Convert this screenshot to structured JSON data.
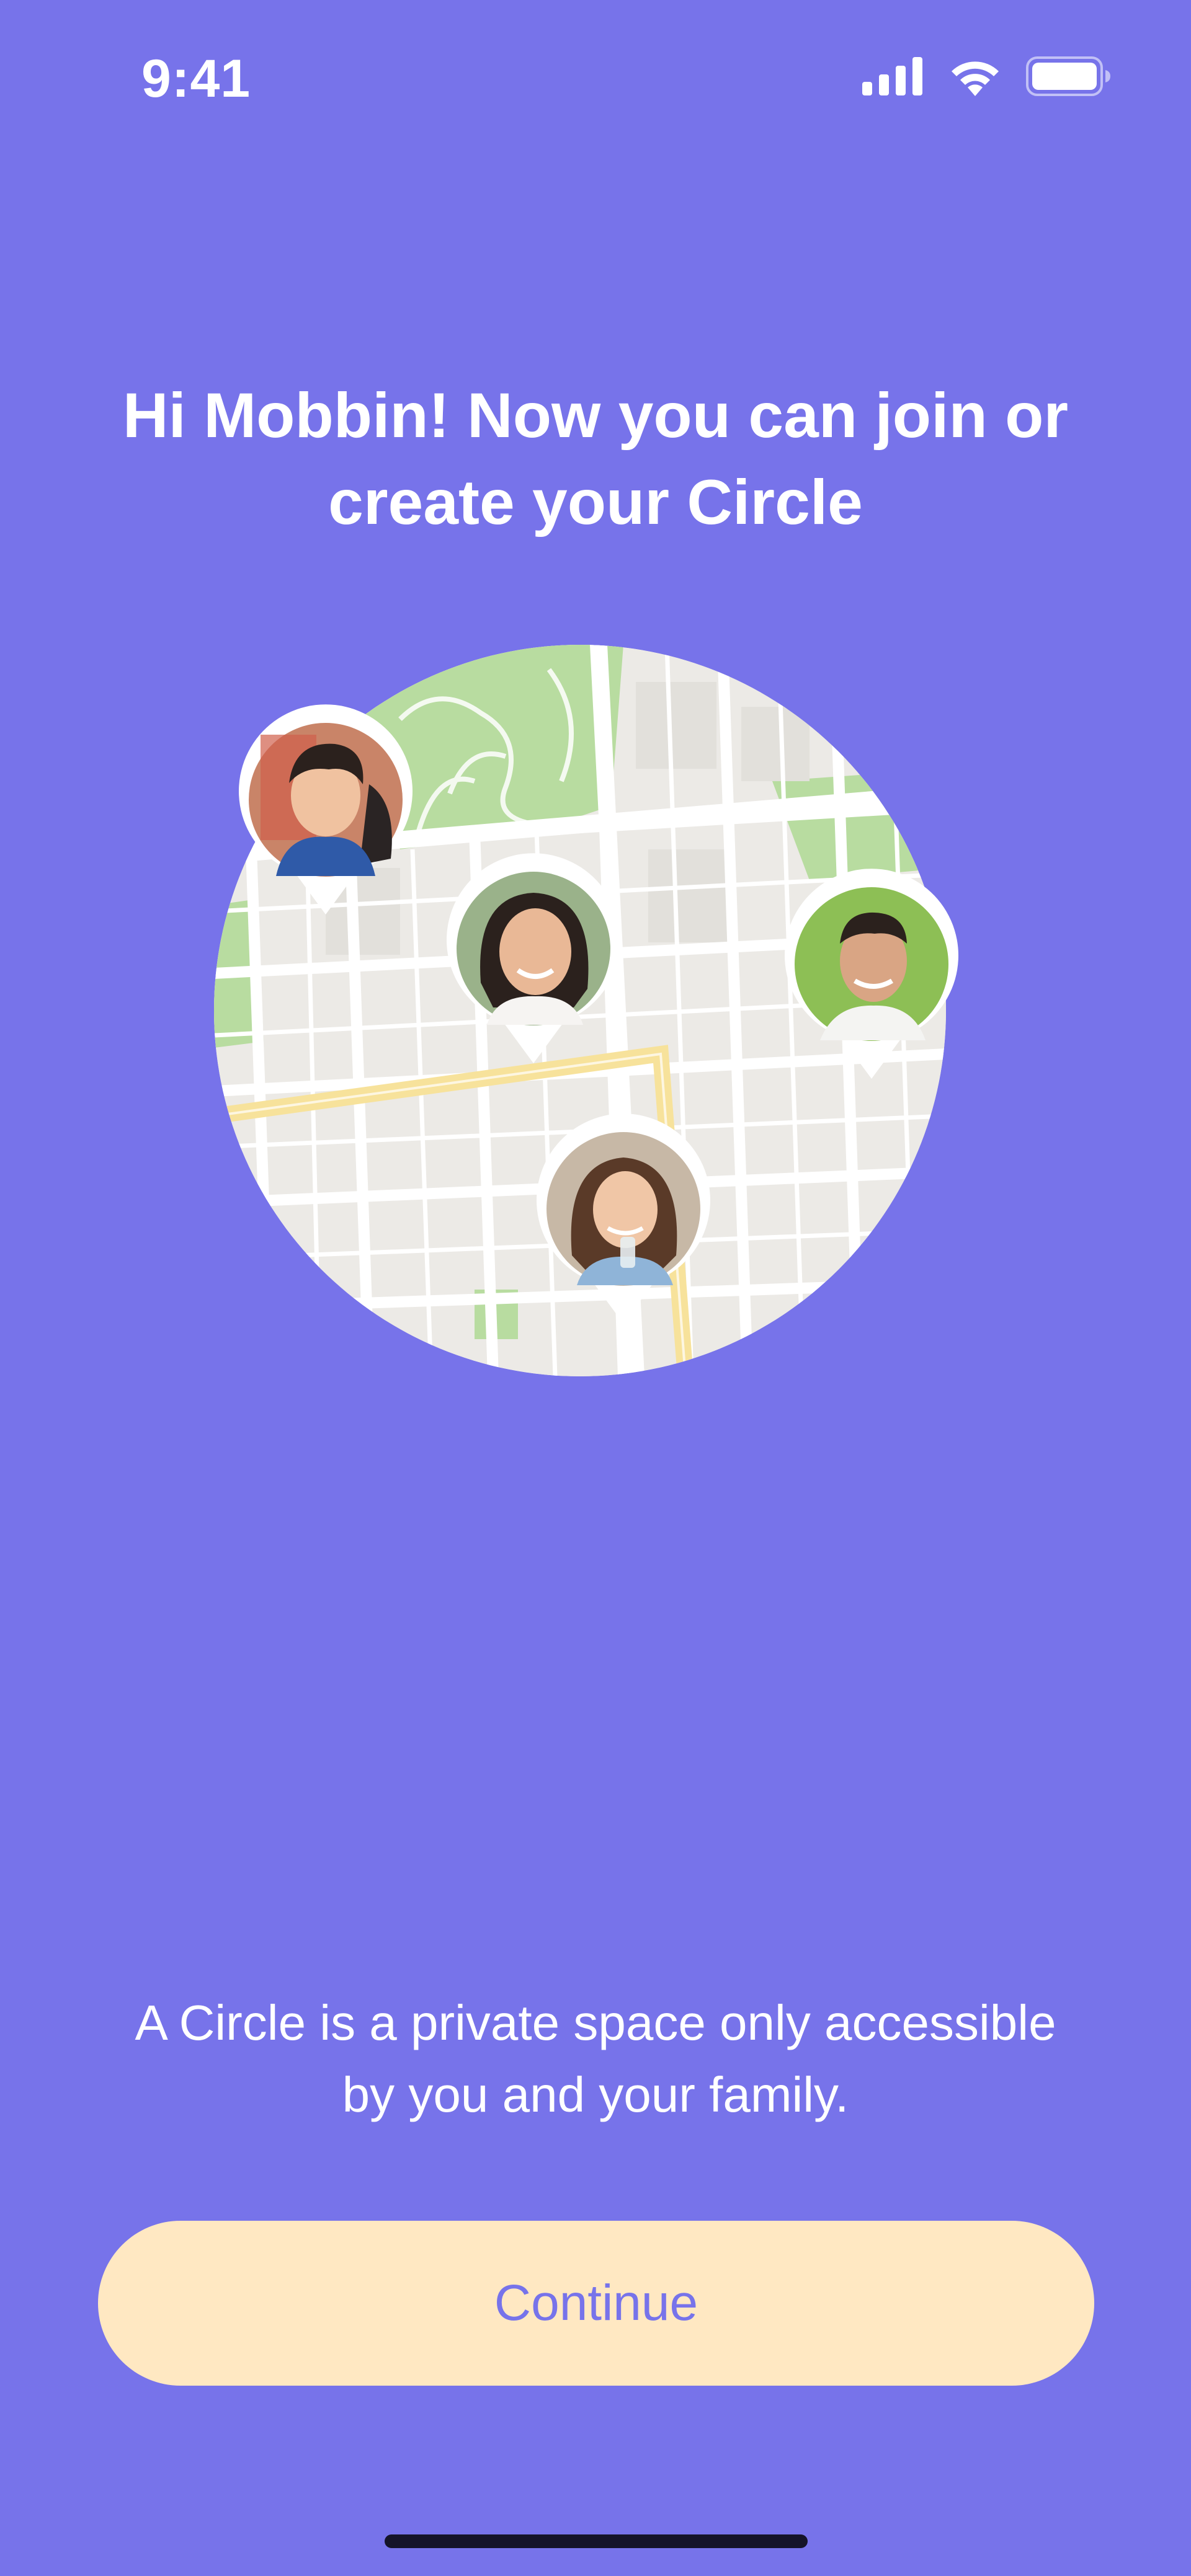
{
  "status_bar": {
    "time": "9:41",
    "icons": [
      "signal-icon",
      "wifi-icon",
      "battery-icon"
    ]
  },
  "onboarding": {
    "heading_line1": "Hi Mobbin! Now you can join or",
    "heading_line2": "create your Circle",
    "description_line1": "A Circle is a private space only accessible",
    "description_line2": "by you and your family.",
    "continue_label": "Continue"
  },
  "illustration": {
    "type": "map-with-member-pins",
    "members": [
      "teen-boy-avatar",
      "woman-avatar",
      "man-avatar",
      "girl-avatar"
    ]
  },
  "colors": {
    "background": "#7773EA",
    "button_bg": "#FFE8C2",
    "button_text": "#7773EA",
    "text": "#FFFFFF",
    "map_base": "#ECEAE6",
    "map_road": "#FFFFFF",
    "map_park": "#B8DCA0",
    "map_highway": "#F7E29B"
  }
}
